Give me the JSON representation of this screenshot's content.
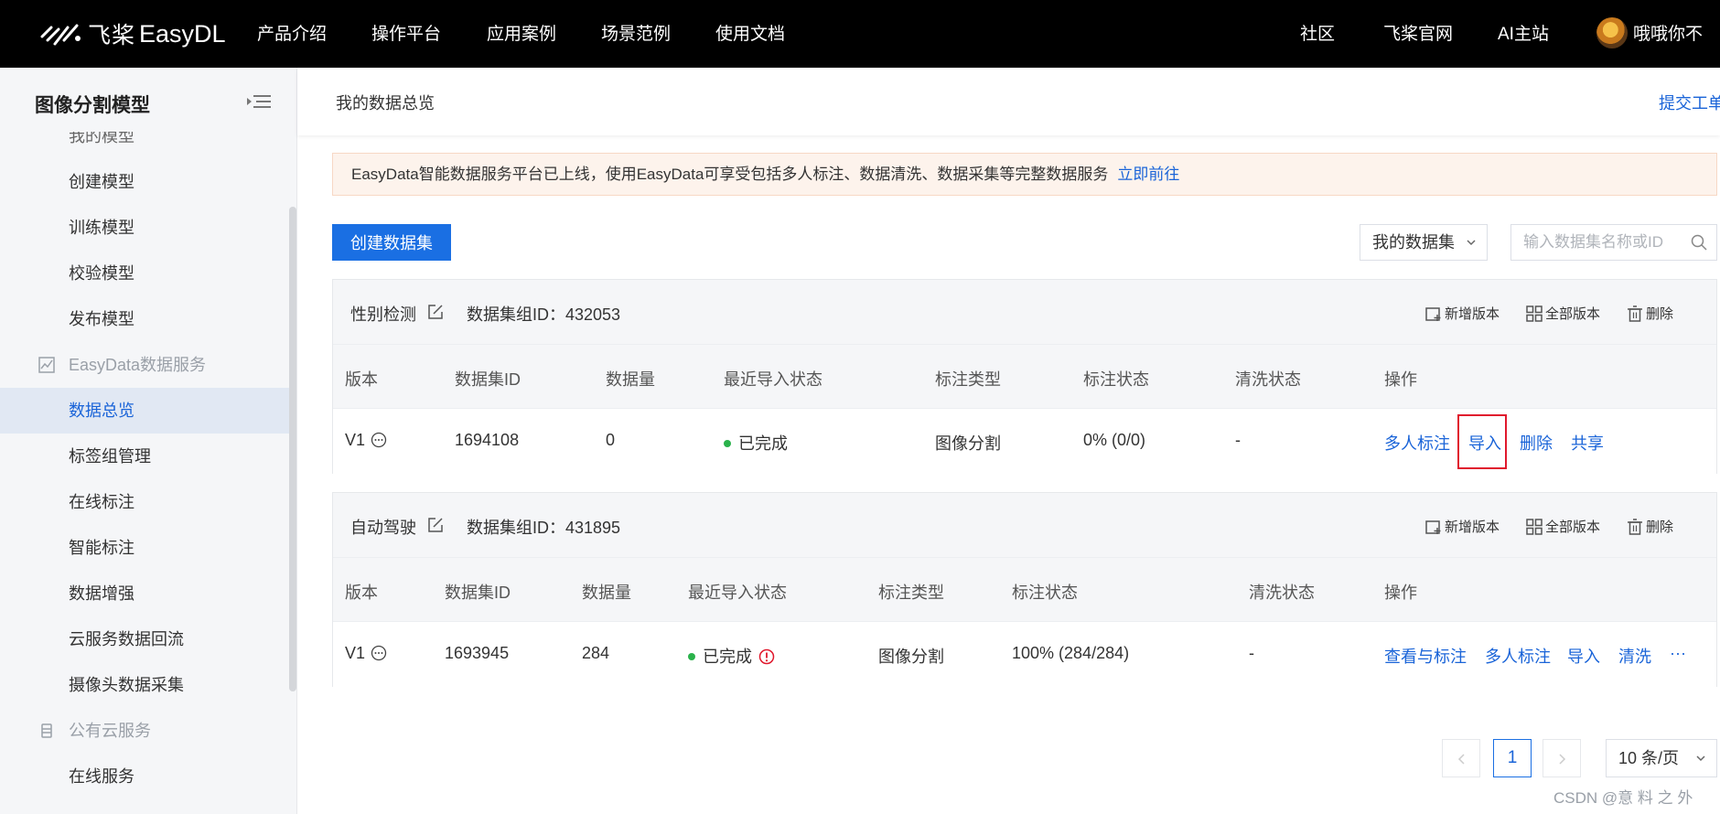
{
  "topnav": {
    "logo_cn": "飞桨",
    "logo_en": "EasyDL",
    "links": [
      "产品介绍",
      "操作平台",
      "应用案例",
      "场景范例",
      "使用文档"
    ],
    "right_links": [
      "社区",
      "飞桨官网",
      "AI主站"
    ],
    "username": "哦哦你不"
  },
  "sidebar": {
    "title": "图像分割模型",
    "clipped_item": "我的模型",
    "items_a": [
      "创建模型",
      "训练模型",
      "校验模型",
      "发布模型"
    ],
    "group1": "EasyData数据服务",
    "items_b": [
      "数据总览",
      "标签组管理",
      "在线标注",
      "智能标注",
      "数据增强",
      "云服务数据回流",
      "摄像头数据采集"
    ],
    "group2": "公有云服务",
    "items_c": [
      "在线服务"
    ],
    "active": "数据总览"
  },
  "header": {
    "page_title": "我的数据总览",
    "ticket": "提交工单"
  },
  "banner": {
    "text": "EasyData智能数据服务平台已上线，使用EasyData可享受包括多人标注、数据清洗、数据采集等完整数据服务",
    "link": "立即前往"
  },
  "toolbar": {
    "create_button": "创建数据集",
    "filter_value": "我的数据集",
    "search_placeholder": "输入数据集名称或ID"
  },
  "head_actions": [
    "新增版本",
    "全部版本",
    "删除"
  ],
  "datasets": [
    {
      "name": "性别检测",
      "group_id": "数据集组ID：432053",
      "columns": [
        "版本",
        "数据集ID",
        "数据量",
        "最近导入状态",
        "标注类型",
        "标注状态",
        "清洗状态",
        "操作"
      ],
      "row": {
        "version": "V1",
        "id": "1694108",
        "count": "0",
        "import_status": "已完成",
        "label_type": "图像分割",
        "label_status": "0% (0/0)",
        "clean_status": "-",
        "ops": [
          "多人标注",
          "导入",
          "删除",
          "共享"
        ]
      }
    },
    {
      "name": "自动驾驶",
      "group_id": "数据集组ID：431895",
      "columns": [
        "版本",
        "数据集ID",
        "数据量",
        "最近导入状态",
        "标注类型",
        "标注状态",
        "清洗状态",
        "操作"
      ],
      "row": {
        "version": "V1",
        "id": "1693945",
        "count": "284",
        "import_status": "已完成",
        "label_type": "图像分割",
        "label_status": "100% (284/284)",
        "clean_status": "-",
        "ops": [
          "查看与标注",
          "多人标注",
          "导入",
          "清洗",
          "···"
        ]
      }
    }
  ],
  "pagination": {
    "current": "1",
    "page_size": "10 条/页"
  },
  "watermark": "CSDN @意 料 之 外",
  "colors": {
    "accent": "#1a6fe3",
    "link": "#1a64d8",
    "success": "#2ab24b",
    "warning": "#e0182d",
    "nav_bg": "#000000"
  }
}
